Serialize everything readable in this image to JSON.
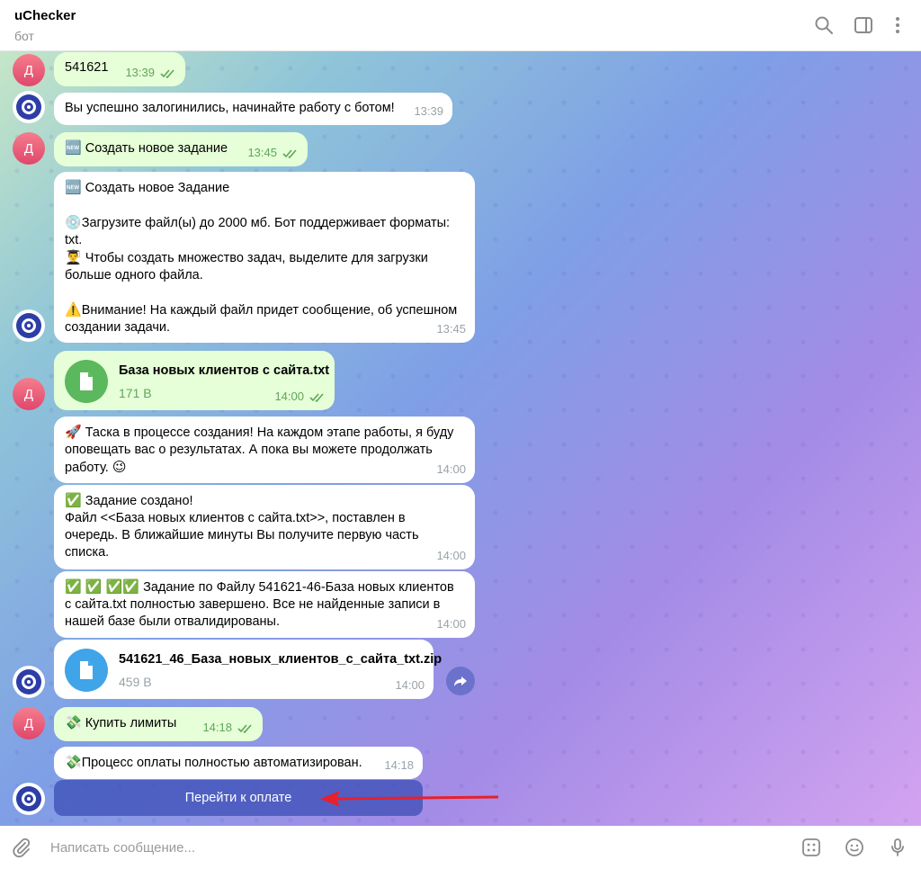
{
  "header": {
    "title": "uChecker",
    "subtitle": "бот",
    "icons": [
      "search-icon",
      "sidebar-toggle-icon",
      "more-vertical-icon"
    ]
  },
  "user_avatar_letter": "Д",
  "messages": [
    {
      "from": "user",
      "text": "541621",
      "time": "13:39"
    },
    {
      "from": "bot",
      "text": "Вы успешно залогинились, начинайте работу с ботом!",
      "time": "13:39"
    },
    {
      "from": "user",
      "emoji": "🆕",
      "text": "Создать новое задание",
      "time": "13:45"
    },
    {
      "from": "bot",
      "line1": "Создать новое Задание",
      "line2": "Загрузите файл(ы) до 2000 мб. Бот поддерживает форматы:",
      "line3": "txt.",
      "line4": "Чтобы создать множество задач, выделите для загрузки",
      "line5": "больше одного файла.",
      "line6": "Внимание! На каждый файл придет сообщение, об успешном",
      "line7": "создании задачи.",
      "time": "13:45"
    },
    {
      "from": "user",
      "type": "file",
      "filename": "База новых клиентов с сайта.txt",
      "size": "171 B",
      "time": "14:00"
    },
    {
      "from": "bot",
      "line1": "Таска в процессе создания! На каждом этапе работы, я буду",
      "line2": "оповещать вас о результатах. А пока вы можете продолжать",
      "line3": "работу.",
      "time": "14:00"
    },
    {
      "from": "bot",
      "line1": "Задание создано!",
      "line2": " Файл <<База новых клиентов с сайта.txt>>, поставлен в",
      "line3": "очередь. В ближайшие минуты Вы получите первую часть",
      "line4": "списка.",
      "time": "14:00"
    },
    {
      "from": "bot",
      "line1": "Задание по Файлу 541621-46-База новых клиентов",
      "line2": "с сайта.txt полностью завершено. Все не найденные записи в",
      "line3": "нашей базе были отвалидированы.",
      "time": "14:00"
    },
    {
      "from": "bot",
      "type": "file",
      "filename": "541621_46_База_новых_клиентов_с_сайта_txt.zip",
      "size": "459 B",
      "time": "14:00"
    },
    {
      "from": "user",
      "emoji": "💸",
      "text": "Купить лимиты",
      "time": "14:18"
    },
    {
      "from": "bot",
      "emoji": "💸",
      "text": "Процесс оплаты полностью автоматизирован.",
      "time": "14:18"
    }
  ],
  "keyboard_button": "Перейти к оплате",
  "composer": {
    "placeholder": "Написать сообщение...",
    "icons": [
      "attach-icon",
      "bot-commands-icon",
      "emoji-icon",
      "microphone-icon"
    ]
  },
  "colors": {
    "outgoing_bubble": "#e6ffd8",
    "incoming_bubble": "#ffffff",
    "file_icon_green": "#5cb85c",
    "file_icon_blue": "#3fa4e8",
    "arrow_red": "#e8202a"
  }
}
